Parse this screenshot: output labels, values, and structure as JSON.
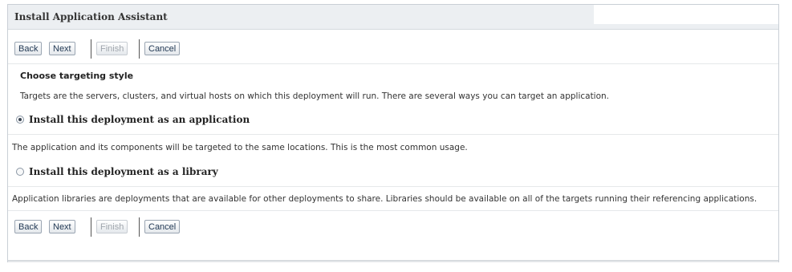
{
  "window": {
    "title": "Install Application Assistant"
  },
  "toolbar_top": {
    "back": "Back",
    "next": "Next",
    "finish": "Finish",
    "cancel": "Cancel"
  },
  "section": {
    "title": "Choose targeting style",
    "description": "Targets are the servers, clusters, and virtual hosts on which this deployment will run. There are several ways you can target an application."
  },
  "options": [
    {
      "label": "Install this deployment as an application",
      "selected": true,
      "description": "The application and its components will be targeted to the same locations. This is the most common usage."
    },
    {
      "label": "Install this deployment as a library",
      "selected": false,
      "description": "Application libraries are deployments that are available for other deployments to share. Libraries should be available on all of the targets running their referencing applications."
    }
  ],
  "toolbar_bottom": {
    "back": "Back",
    "next": "Next",
    "finish": "Finish",
    "cancel": "Cancel"
  }
}
